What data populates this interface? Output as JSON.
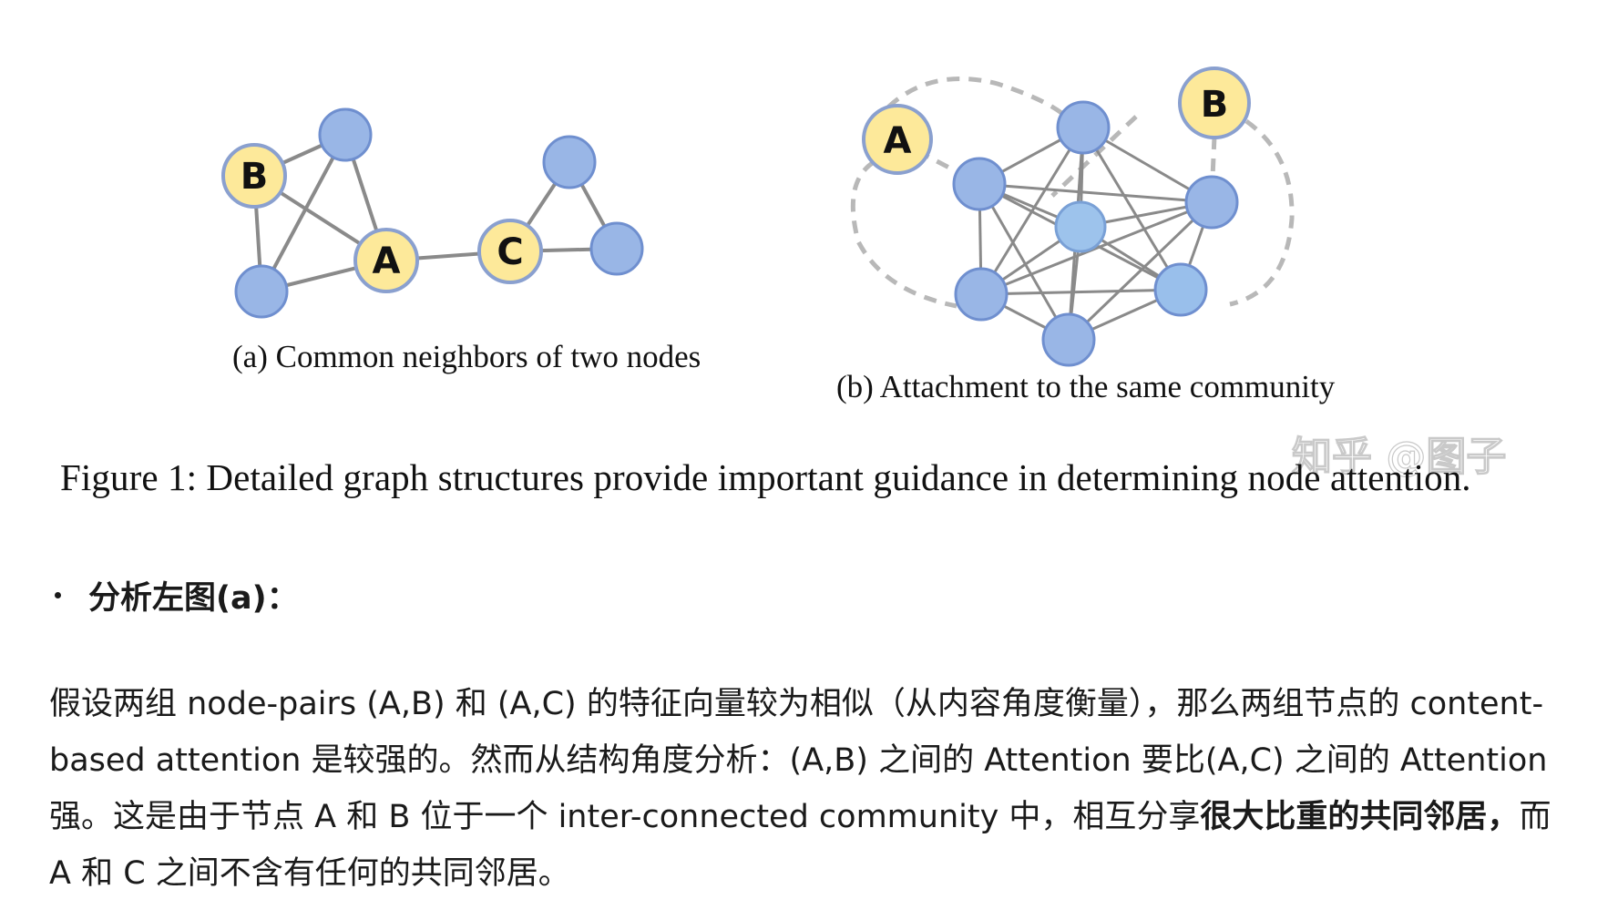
{
  "figure": {
    "panel_a": {
      "caption": "(a) Common neighbors of two nodes",
      "labels": {
        "A": "A",
        "B": "B",
        "C": "C"
      }
    },
    "panel_b": {
      "caption": "(b) Attachment to the same community",
      "labels": {
        "A": "A",
        "B": "B"
      }
    },
    "main_caption": "Figure 1: Detailed graph structures provide important guidance in determining node attention.",
    "watermark": "知乎 @图子",
    "colors": {
      "labeled_node_fill": "#fde99a",
      "labeled_node_stroke": "#8aa0cf",
      "plain_node_fill": "#99b6e6",
      "plain_node_stroke": "#6f8fcf",
      "edge": "#8a8a8a",
      "dashed_edge": "#b8b8b8"
    }
  },
  "bullet": {
    "text": "分析左图(a)："
  },
  "paragraph": {
    "part1": "假设两组 node-pairs (A,B) 和 (A,C) 的特征向量较为相似（从内容角度衡量），那么两组节点的 content-based attention 是较强的。然而从结构角度分析：(A,B) 之间的 Attention 要比(A,C) 之间的 Attention 强。这是由于节点 A 和 B 位于一个 inter-connected community 中，相互分享",
    "bold": "很大比重的共同邻居，",
    "part2": "而 A 和 C 之间不含有任何的共同邻居。"
  }
}
